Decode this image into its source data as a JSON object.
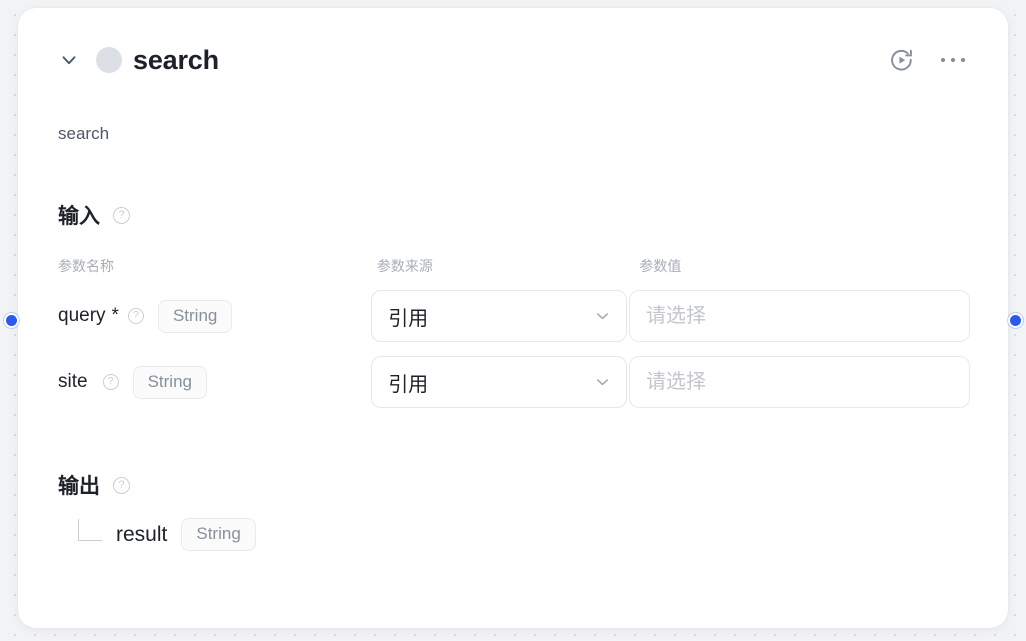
{
  "node": {
    "title": "search",
    "description": "search",
    "avatar_icon": "node-avatar-placeholder",
    "collapse_icon": "chevron-down-icon",
    "run_icon": "run-play-circle-icon",
    "more_icon": "more-horizontal-icon"
  },
  "ports": {
    "input_port_name": "input-connection-port",
    "output_port_name": "output-connection-port",
    "color": "#2b5aed"
  },
  "input_section": {
    "title": "输入",
    "help": "?",
    "columns": {
      "name": "参数名称",
      "source": "参数来源",
      "value": "参数值"
    },
    "rows": [
      {
        "name": "query",
        "required_marker": "*",
        "help": "?",
        "type": "String",
        "source": "引用",
        "value": "",
        "value_placeholder": "请选择"
      },
      {
        "name": "site",
        "required_marker": "",
        "help": "?",
        "type": "String",
        "source": "引用",
        "value": "",
        "value_placeholder": "请选择"
      }
    ]
  },
  "output_section": {
    "title": "输出",
    "help": "?",
    "rows": [
      {
        "name": "result",
        "type": "String"
      }
    ]
  },
  "colors": {
    "accent": "#2b5aed",
    "text_primary": "#1d2129",
    "text_secondary": "#4e5969",
    "text_muted": "#86909c",
    "placeholder": "#c3c6cd",
    "border": "#e5e6eb",
    "card_bg": "#ffffff",
    "canvas_bg": "#f2f3f5"
  }
}
